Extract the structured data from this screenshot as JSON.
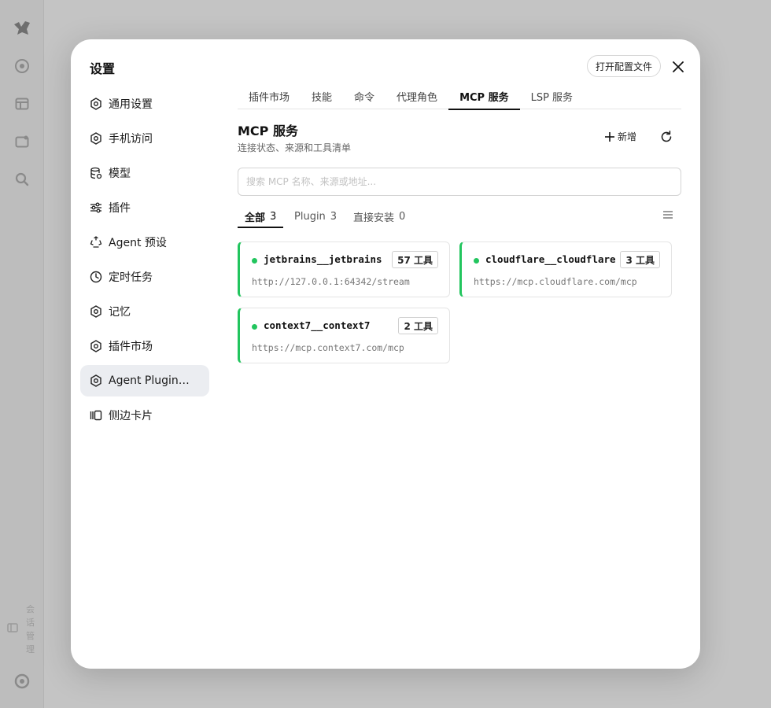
{
  "rail": {
    "vertical_text": "会话管理"
  },
  "modal": {
    "title": "设置",
    "open_config_label": "打开配置文件"
  },
  "sidebar": {
    "items": [
      {
        "label": "通用设置",
        "icon": "gear-icon"
      },
      {
        "label": "手机访问",
        "icon": "gear-icon"
      },
      {
        "label": "模型",
        "icon": "database-icon"
      },
      {
        "label": "插件",
        "icon": "sliders-icon"
      },
      {
        "label": "Agent 预设",
        "icon": "recycle-icon"
      },
      {
        "label": "定时任务",
        "icon": "clock-icon"
      },
      {
        "label": "记忆",
        "icon": "gear-icon"
      },
      {
        "label": "插件市场",
        "icon": "gear-icon"
      },
      {
        "label": "Agent Plugins ...",
        "icon": "gear-icon",
        "active": true
      },
      {
        "label": "侧边卡片",
        "icon": "cards-icon"
      }
    ]
  },
  "tabs": [
    {
      "label": "插件市场"
    },
    {
      "label": "技能"
    },
    {
      "label": "命令"
    },
    {
      "label": "代理角色"
    },
    {
      "label": "MCP 服务",
      "active": true
    },
    {
      "label": "LSP 服务"
    }
  ],
  "section": {
    "title": "MCP 服务",
    "subtitle": "连接状态、来源和工具清单",
    "add_label": "新增"
  },
  "search": {
    "placeholder": "搜索 MCP 名称、来源或地址...",
    "value": ""
  },
  "filters": [
    {
      "label": "全部",
      "count": "3",
      "active": true
    },
    {
      "label": "Plugin",
      "count": "3"
    },
    {
      "label": "直接安装",
      "count": "0"
    }
  ],
  "servers": [
    {
      "name": "jetbrains__jetbrains",
      "tools": "57 工具",
      "url": "http://127.0.0.1:64342/stream",
      "status_color": "#22c55e"
    },
    {
      "name": "cloudflare__cloudflare",
      "tools": "3 工具",
      "url": "https://mcp.cloudflare.com/mcp",
      "status_color": "#22c55e"
    },
    {
      "name": "context7__context7",
      "tools": "2 工具",
      "url": "https://mcp.context7.com/mcp",
      "status_color": "#22c55e"
    }
  ],
  "colors": {
    "accent_green": "#22c55e",
    "active_bg": "#ebedf1"
  }
}
